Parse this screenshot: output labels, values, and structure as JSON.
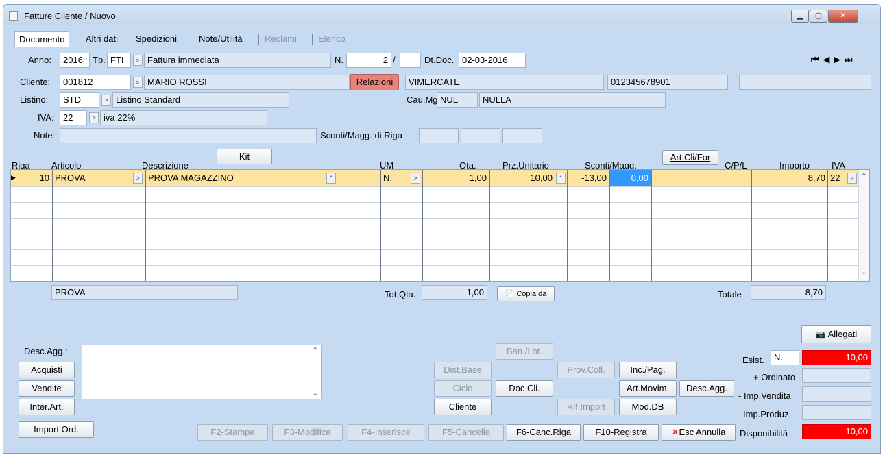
{
  "window": {
    "title": "Fatture Cliente / Nuovo"
  },
  "tabs": [
    {
      "label": "Documento"
    },
    {
      "label": "Altri dati"
    },
    {
      "label": "Spedizioni"
    },
    {
      "label": "Note/Utilità"
    },
    {
      "label": "Reclami"
    },
    {
      "label": "Elenco"
    }
  ],
  "header": {
    "anno_label": "Anno:",
    "anno": "2016",
    "tp_label": "Tp.",
    "tp": "FTI",
    "tp_desc": "Fattura immediata",
    "n_label": "N.",
    "n": "2",
    "n_sep": "/",
    "n_suffix": "",
    "dtdoc_label": "Dt.Doc.",
    "dtdoc": "02-03-2016",
    "cliente_label": "Cliente:",
    "cliente_code": "001812",
    "cliente_name": "MARIO ROSSI",
    "relazioni": "Relazioni",
    "citta": "VIMERCATE",
    "piva": "012345678901",
    "extra": "",
    "listino_label": "Listino:",
    "listino": "STD",
    "listino_desc": "Listino Standard",
    "caumg_label": "Cau.Mg",
    "caumg": "NUL",
    "caumg_desc": "NULLA",
    "iva_label": "IVA:",
    "iva": "22",
    "iva_desc": "iva 22%",
    "note_label": "Note:",
    "note": "",
    "sconti_label": "Sconti/Magg. di Riga",
    "sconti1": "",
    "sconti2": "",
    "sconti3": ""
  },
  "nav": {
    "first": "⏮",
    "prev": "◀",
    "next": "▶",
    "last": "⏭"
  },
  "grid": {
    "kit_button": "Kit",
    "artclifor_button": "Art.Cli/For",
    "columns": {
      "riga": "Riga",
      "articolo": "Articolo",
      "descrizione": "Descrizione",
      "um": "UM",
      "qta": "Qta.",
      "prz": "Prz.Unitario",
      "sconti": "Sconti/Magg.",
      "cpl": "C/P/L",
      "importo": "Importo",
      "iva": "IVA"
    },
    "rows": [
      {
        "riga": "10",
        "articolo": "PROVA",
        "descrizione": "PROVA MAGAZZINO",
        "um": "N.",
        "qta": "1,00",
        "prz": "10,00",
        "sconto1": "-13,00",
        "sconto2": "0,00",
        "importo": "8,70",
        "iva": "22"
      }
    ]
  },
  "footer": {
    "articolo_desc": "PROVA",
    "totqta_label": "Tot.Qta.",
    "totqta": "1,00",
    "copia_da": "Copia da",
    "totale_label": "Totale",
    "totale": "8,70"
  },
  "bottom": {
    "descagg_label": "Desc.Agg.:",
    "acquisti": "Acquisti",
    "vendite": "Vendite",
    "interart": "Inter.Art.",
    "importord": "Import Ord.",
    "banlot": "Ban./Lot.",
    "distbase": "Dist.Base",
    "ciclo": "Ciclo",
    "doccli": "Doc.Cli.",
    "cliente": "Cliente",
    "provcoll": "Prov.Coll.",
    "rifimport": "Rif.Import",
    "incpag": "Inc./Pag.",
    "artmovim": "Art.Movim.",
    "moddb": "Mod.DB",
    "descagg_btn": "Desc.Agg.",
    "allegati": "Allegati",
    "esist_label": "Esist.",
    "esist_um": "N.",
    "esist": "-10,00",
    "ordinato_label": "+ Ordinato",
    "ordinato": "",
    "impvendita_label": "- Imp.Vendita",
    "impvendita": "",
    "impproduz_label": "Imp.Produz.",
    "impproduz": "",
    "disponibilita_label": "Disponibilità",
    "disponibilita": "-10,00",
    "f2": "F2-Stampa",
    "f3": "F3-Modifica",
    "f4": "F4-Inserisce",
    "f5": "F5-Cancella",
    "f6": "F6-Canc.Riga",
    "f10": "F10-Registra",
    "esc": "Esc Annulla"
  }
}
